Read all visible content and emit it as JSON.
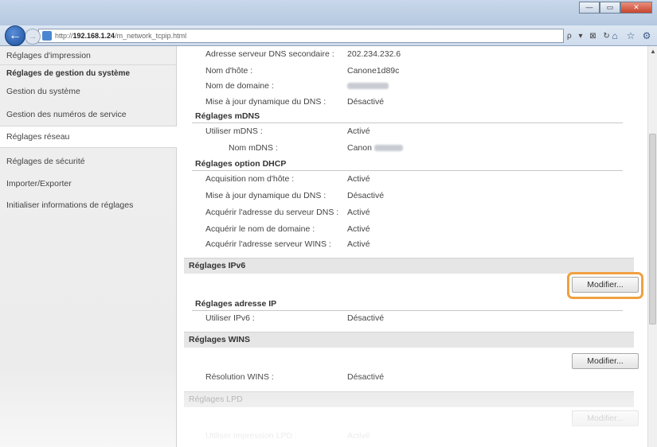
{
  "browser": {
    "url_prefix": "http://",
    "url_host": "192.168.1.24",
    "url_path": "/m_network_tcpip.html",
    "address_tools": "ρ ▾ ⊠ ↻",
    "window_buttons": [
      "—",
      "▭",
      "✕"
    ]
  },
  "sidebar": {
    "items": [
      {
        "label": "Réglages d'impression"
      },
      {
        "label": "Réglages de gestion du système"
      },
      {
        "label": "Gestion du système"
      },
      {
        "label": "Gestion des numéros de service"
      },
      {
        "label": "Réglages réseau"
      },
      {
        "label": "Réglages de sécurité"
      },
      {
        "label": "Importer/Exporter"
      },
      {
        "label": "Initialiser informations de réglages"
      }
    ]
  },
  "ipv4": {
    "dns_secondary_label": "Adresse serveur DNS secondaire :",
    "dns_secondary_value": "202.234.232.6",
    "hostname_label": "Nom d'hôte :",
    "hostname_value": "Canone1d89c",
    "domain_label": "Nom de domaine :",
    "dyn_dns_label": "Mise à jour dynamique du DNS :",
    "dyn_dns_value": "Désactivé"
  },
  "mdns": {
    "heading": "Réglages mDNS",
    "use_label": "Utiliser mDNS :",
    "use_value": "Activé",
    "name_label": "Nom mDNS :",
    "name_value": "Canon"
  },
  "dhcp": {
    "heading": "Réglages option DHCP",
    "rows": [
      {
        "label": "Acquisition nom d'hôte :",
        "value": "Activé"
      },
      {
        "label": "Mise à jour dynamique du DNS :",
        "value": "Désactivé"
      },
      {
        "label": "Acquérir l'adresse du serveur DNS :",
        "value": "Activé"
      },
      {
        "label": "Acquérir le nom de domaine :",
        "value": "Activé"
      },
      {
        "label": "Acquérir l'adresse serveur WINS :",
        "value": "Activé"
      }
    ]
  },
  "ipv6": {
    "section_title": "Réglages IPv6",
    "edit_label": "Modifier...",
    "ip_heading": "Réglages adresse IP",
    "use_label": "Utiliser IPv6 :",
    "use_value": "Désactivé"
  },
  "wins": {
    "section_title": "Réglages WINS",
    "edit_label": "Modifier...",
    "resolution_label": "Résolution WINS :",
    "resolution_value": "Désactivé"
  },
  "lpd": {
    "section_title": "Réglages LPD",
    "edit_label": "Modifier...",
    "use_label": "Utiliser impression LPD :",
    "use_value": "Activé"
  },
  "colors": {
    "highlight": "#f0a040",
    "sidebar_bg": "#efefef",
    "section_bar": "#e6e6e6"
  }
}
